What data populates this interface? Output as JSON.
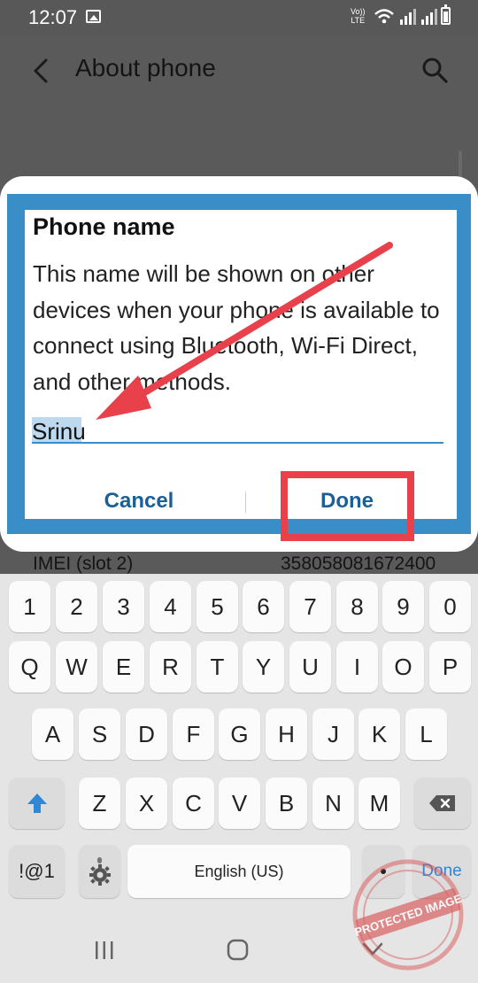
{
  "status_bar": {
    "time": "12:07",
    "volte_line1": "Vo))",
    "volte_line2": "LTE"
  },
  "app_bar": {
    "title": "About phone"
  },
  "dialog": {
    "title": "Phone name",
    "message": "This name will be shown on other devices when your phone is available to connect using Bluetooth, Wi-Fi Direct, and other methods.",
    "input_value": "Srinu",
    "cancel_label": "Cancel",
    "done_label": "Done"
  },
  "behind_row": {
    "label": "IMEI (slot 2)",
    "value": "358058081672400"
  },
  "keyboard": {
    "number_row": [
      "1",
      "2",
      "3",
      "4",
      "5",
      "6",
      "7",
      "8",
      "9",
      "0"
    ],
    "row1": [
      "Q",
      "W",
      "E",
      "R",
      "T",
      "Y",
      "U",
      "I",
      "O",
      "P"
    ],
    "row2": [
      "A",
      "S",
      "D",
      "F",
      "G",
      "H",
      "J",
      "K",
      "L"
    ],
    "row3": [
      "Z",
      "X",
      "C",
      "V",
      "B",
      "N",
      "M"
    ],
    "symbols_label": "!@1",
    "space_label": "English (US)",
    "action_label": "Done"
  },
  "watermark": {
    "text": "PROTECTED IMAGE"
  },
  "colors": {
    "dialog_border": "#3a8ec8",
    "button_text": "#1c5e96",
    "annotation_red": "#e8414b",
    "shift_blue": "#2f87d6"
  }
}
